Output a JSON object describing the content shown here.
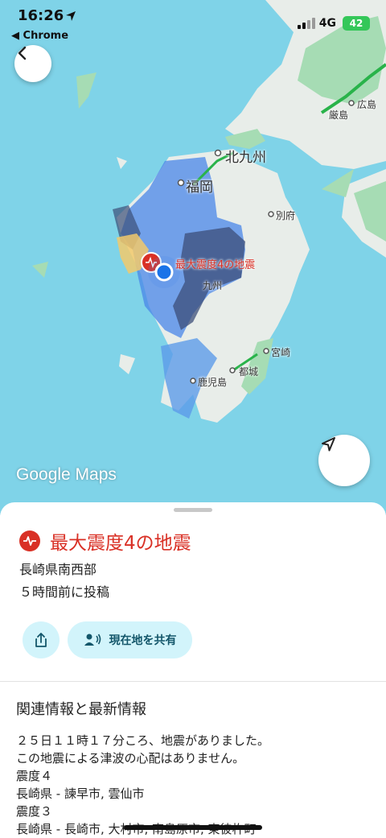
{
  "status_bar": {
    "time": "16:26",
    "back_app": "◀ Chrome",
    "network": "4G",
    "battery": "42"
  },
  "map": {
    "attribution": "Google Maps",
    "quake_marker_label": "最大震度4の地震",
    "places": {
      "kitakyushu": "北九州",
      "fukuoka": "福岡",
      "beppu": "別府",
      "kyushu": "九州",
      "miyazaki": "宮崎",
      "miyakonojo": "都城",
      "kagoshima": "鹿児島",
      "hiroshima": "広島",
      "itsukushima": "厳島"
    }
  },
  "sheet": {
    "title": "最大震度4の地震",
    "location": "長崎県南西部",
    "posted": "５時間前に投稿",
    "share_location_label": "現在地を共有",
    "related_title": "関連情報と最新情報",
    "body_lines": [
      "２５日１１時１７分ころ、地震がありました。",
      "この地震による津波の心配はありません。",
      "震度４",
      "長崎県 - 諫早市, 雲仙市",
      "震度３",
      "長崎県 - 長崎市, 大村市, 南島原市, 東彼杵町"
    ]
  },
  "colors": {
    "sea": "#7fd3e8",
    "land": "#e8ede9",
    "quake_red": "#d93025",
    "chip_bg": "#d2f4fb"
  }
}
